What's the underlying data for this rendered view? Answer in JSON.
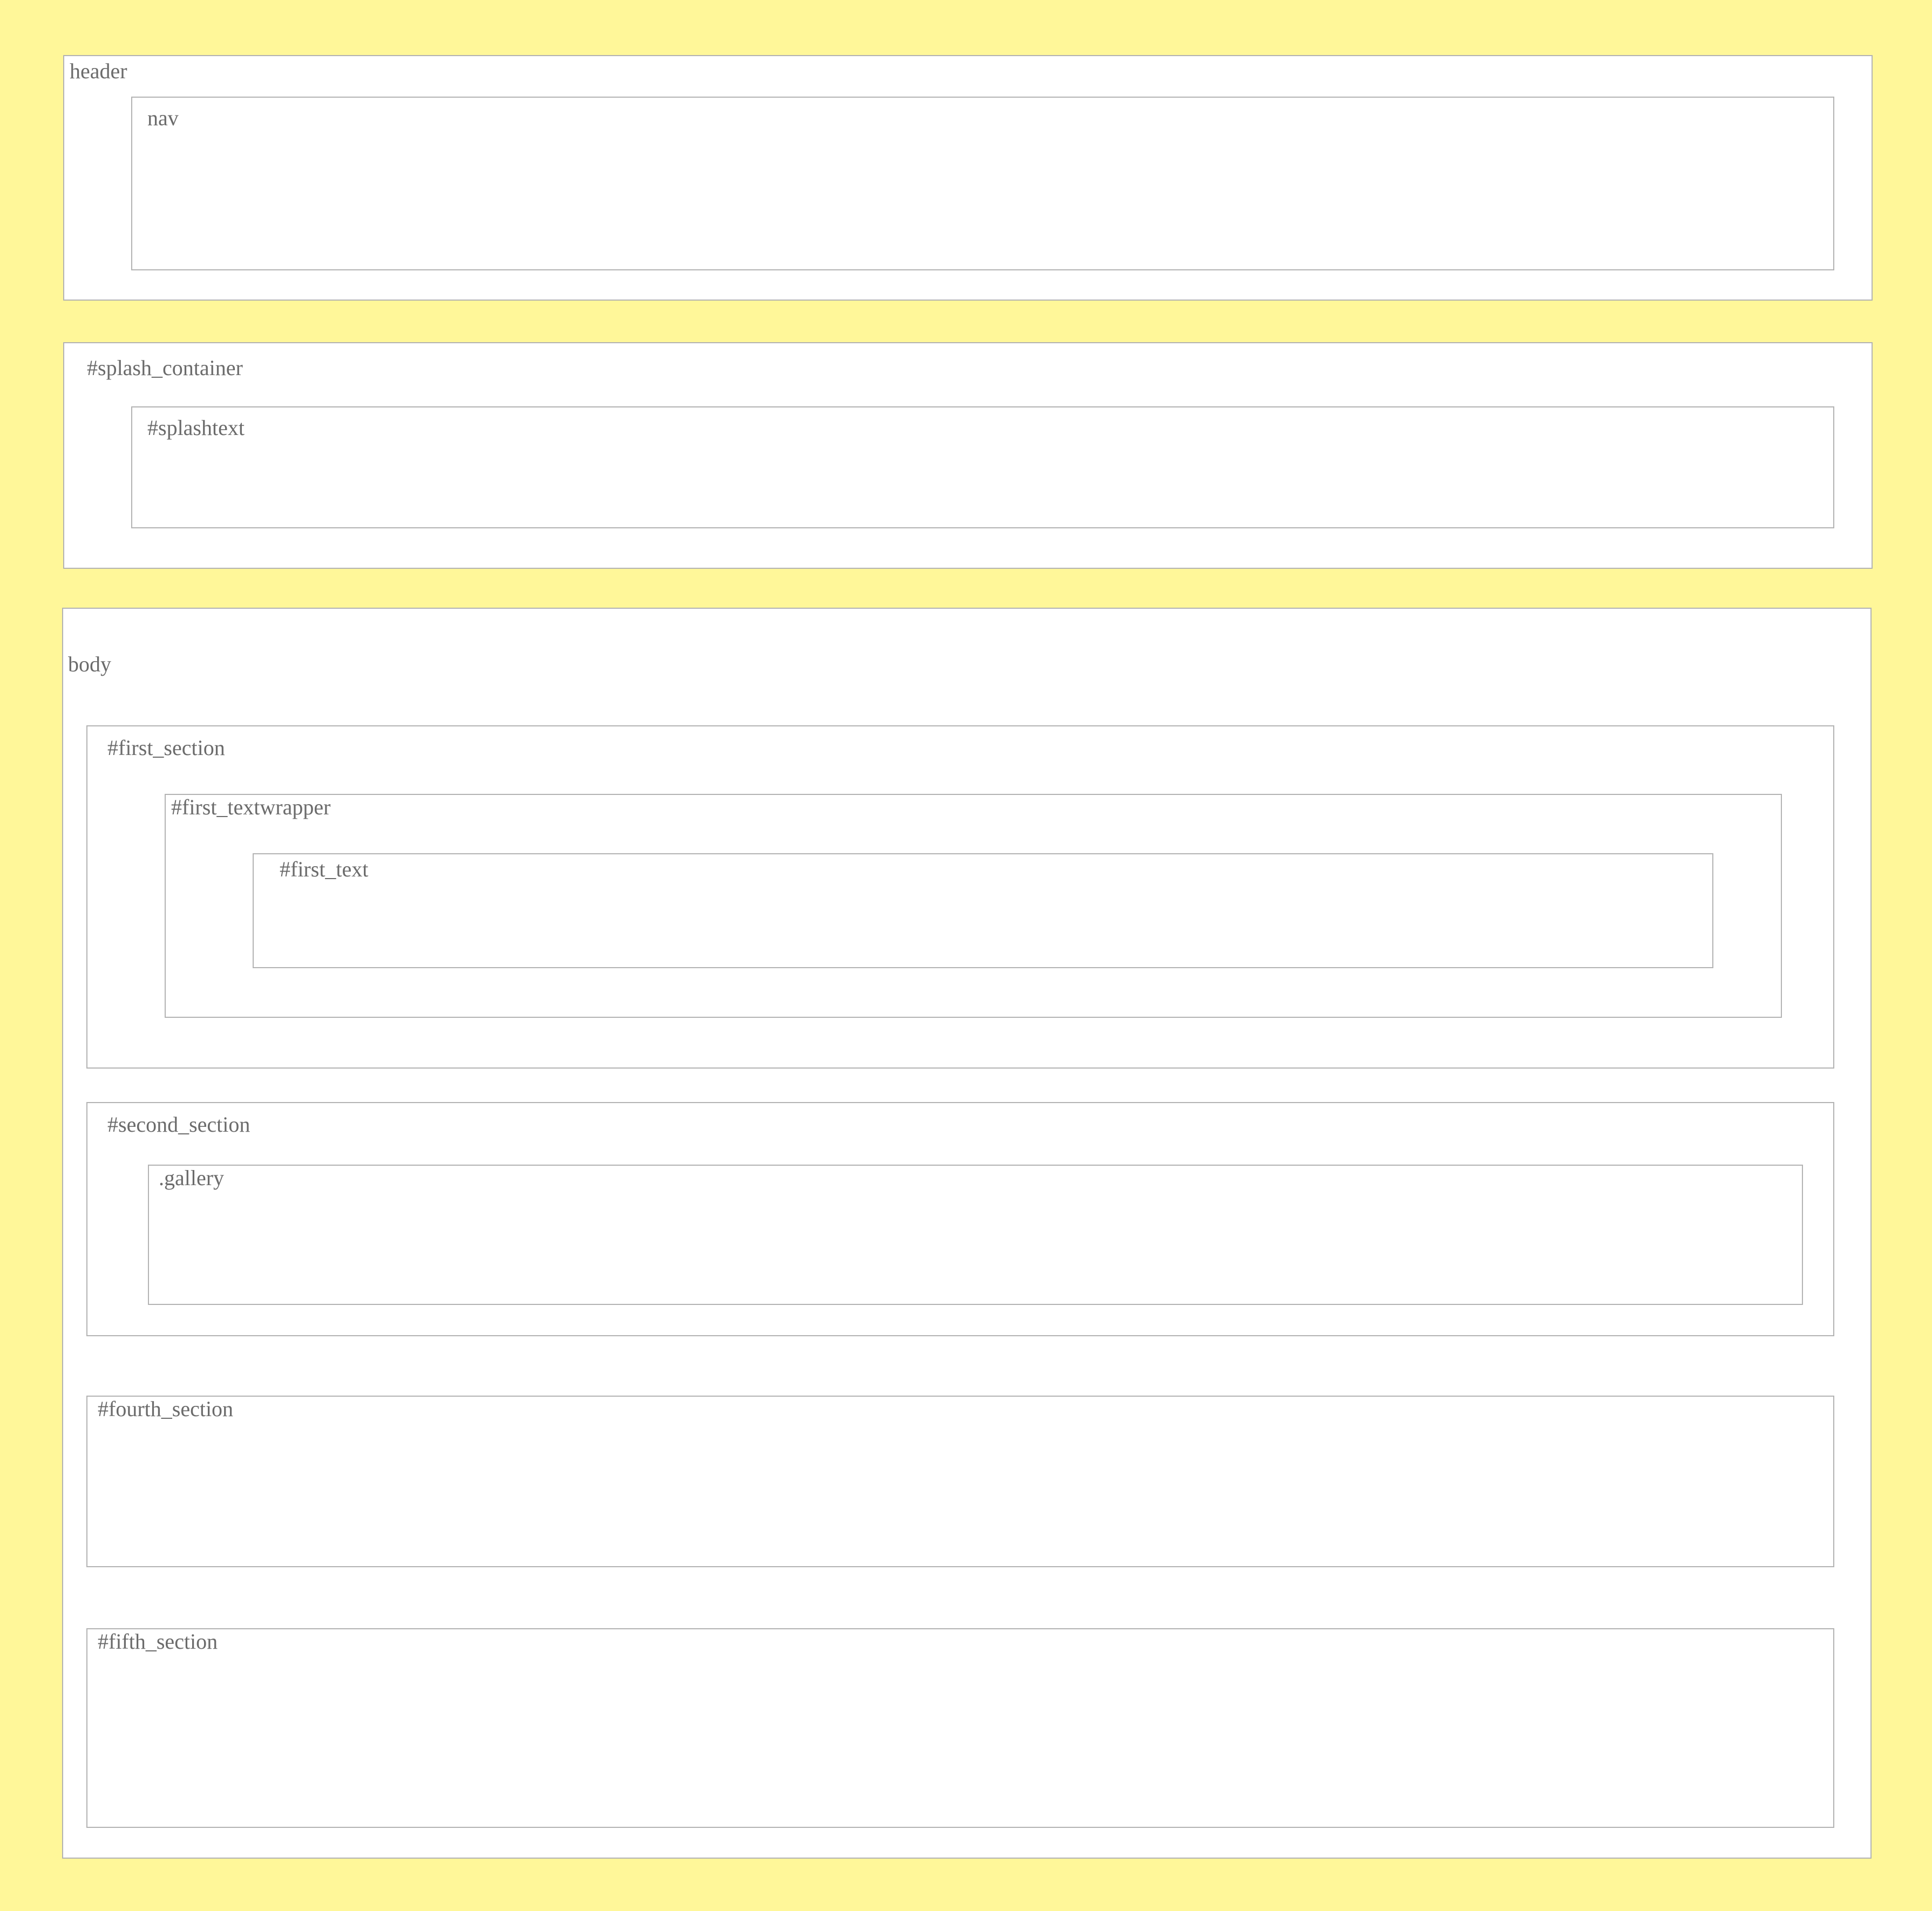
{
  "colors": {
    "background": "#fff799",
    "box_fill": "#ffffff",
    "box_border": "#b3b3b3",
    "label_text": "#6b6b6b"
  },
  "header": {
    "label": "header",
    "nav": {
      "label": "nav"
    }
  },
  "splash_container": {
    "label": "#splash_container",
    "splashtext": {
      "label": "#splashtext"
    }
  },
  "body_section": {
    "label": "body",
    "first_section": {
      "label": "#first_section",
      "first_textwrapper": {
        "label": "#first_textwrapper",
        "first_text": {
          "label": "#first_text"
        }
      }
    },
    "second_section": {
      "label": "#second_section",
      "gallery": {
        "label": ".gallery"
      }
    },
    "fourth_section": {
      "label": "#fourth_section"
    },
    "fifth_section": {
      "label": "#fifth_section"
    }
  }
}
